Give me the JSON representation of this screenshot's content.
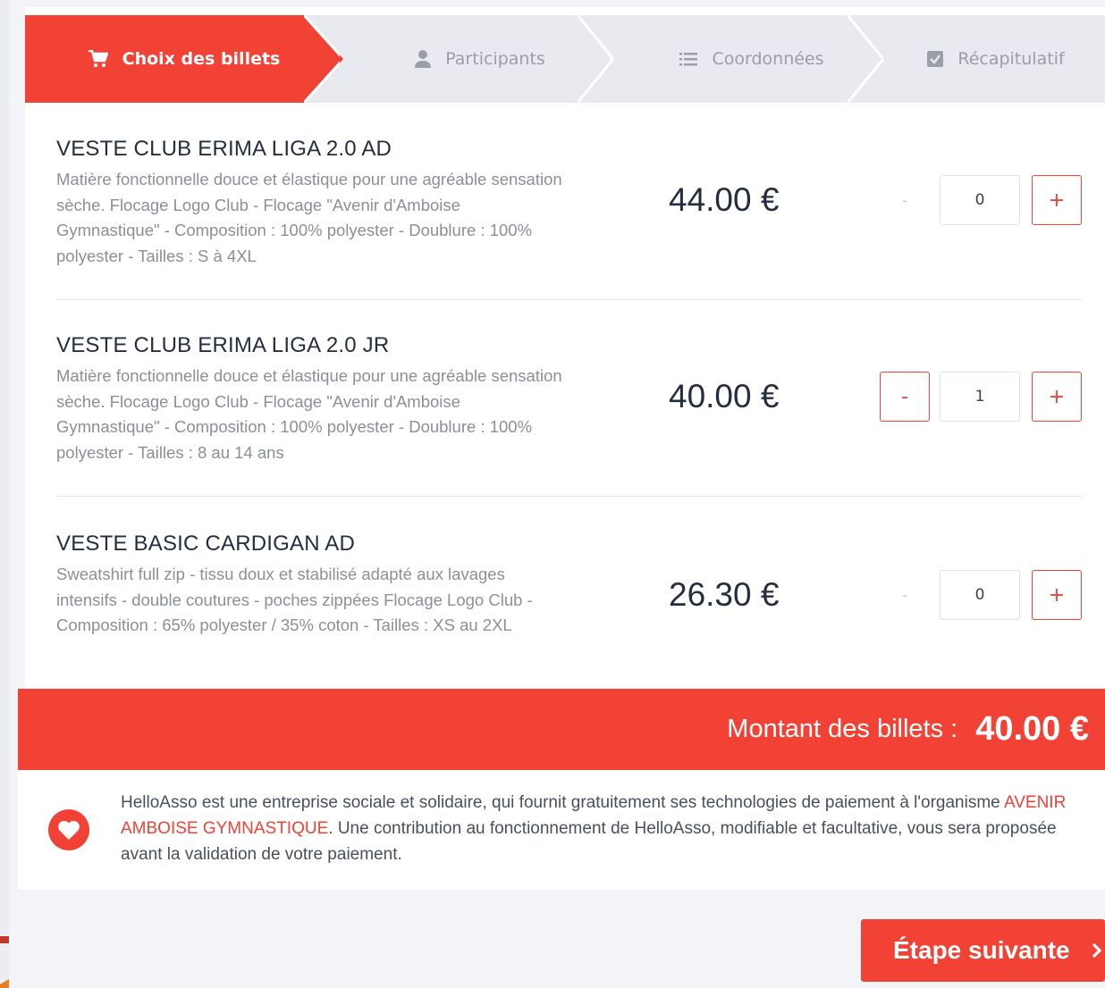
{
  "stepper": {
    "steps": [
      {
        "label": "Choix des billets",
        "icon": "cart-icon",
        "active": true
      },
      {
        "label": "Participants",
        "icon": "user-icon",
        "active": false
      },
      {
        "label": "Coordonnées",
        "icon": "list-icon",
        "active": false
      },
      {
        "label": "Récapitulatif",
        "icon": "check-square-icon",
        "active": false
      }
    ]
  },
  "products": [
    {
      "title": "VESTE CLUB ERIMA LIGA 2.0 AD",
      "description": "Matière fonctionnelle douce et élastique pour une agréable sensation sèche. Flocage Logo Club - Flocage \"Avenir d'Amboise Gymnastique\" - Composition : 100% polyester - Doublure : 100% polyester - Tailles : S à 4XL",
      "price": "44.00 €",
      "quantity": "0",
      "minus": "-",
      "plus": "+"
    },
    {
      "title": "VESTE CLUB ERIMA LIGA 2.0 JR",
      "description": "Matière fonctionnelle douce et élastique pour une agréable sensation sèche. Flocage Logo Club - Flocage \"Avenir d'Amboise Gymnastique\" - Composition : 100% polyester - Doublure : 100% polyester - Tailles : 8 au 14 ans",
      "price": "40.00 €",
      "quantity": "1",
      "minus": "-",
      "plus": "+"
    },
    {
      "title": "VESTE BASIC CARDIGAN AD",
      "description": "Sweatshirt full zip - tissu doux et stabilisé adapté aux lavages intensifs - double coutures - poches zippées Flocage Logo Club - Composition : 65% polyester / 35% coton - Tailles : XS au 2XL",
      "price": "26.30 €",
      "quantity": "0",
      "minus": "-",
      "plus": "+"
    }
  ],
  "total": {
    "label": "Montant des billets :",
    "value": "40.00 €"
  },
  "info": {
    "text_before": "HelloAsso est une entreprise sociale et solidaire, qui fournit gratuitement ses technologies de paiement à l'organisme ",
    "organization": "AVENIR AMBOISE GYMNASTIQUE",
    "text_after": ". Une contribution au fonctionnement de HelloAsso, modifiable et facultative, vous sera proposée avant la validation de votre paiement.",
    "icon": "heart-icon"
  },
  "next_button": {
    "label": "Étape suivante",
    "icon": "chevron-right-icon"
  },
  "colors": {
    "accent": "#f24236",
    "text_dark": "#262d40",
    "text_muted": "#8b8f99",
    "step_bg": "#e9eaef"
  }
}
